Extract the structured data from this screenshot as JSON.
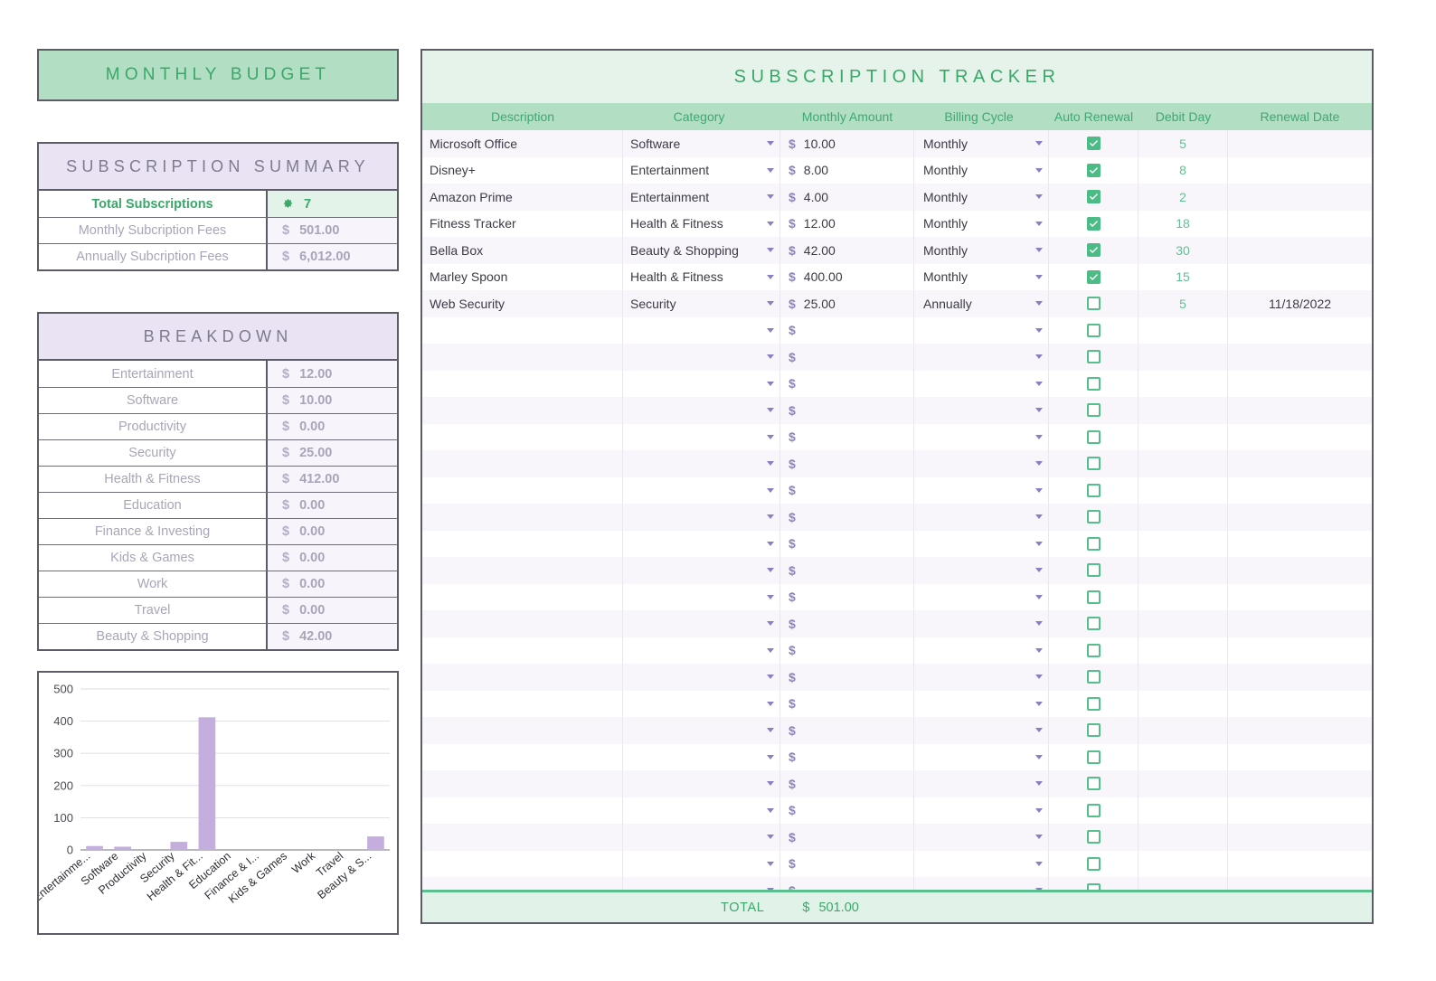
{
  "left": {
    "main_title": "MONTHLY BUDGET",
    "summary": {
      "title": "SUBSCRIPTION SUMMARY",
      "rows": [
        {
          "label": "Total Subscriptions",
          "currency": "",
          "value": "7",
          "icon": "flower-icon",
          "highlight": true
        },
        {
          "label": "Monthly Subcription Fees",
          "currency": "$",
          "value": "501.00",
          "highlight": false
        },
        {
          "label": "Annually Subcription Fees",
          "currency": "$",
          "value": "6,012.00",
          "highlight": false
        }
      ]
    },
    "breakdown": {
      "title": "BREAKDOWN",
      "rows": [
        {
          "label": "Entertainment",
          "currency": "$",
          "value": "12.00"
        },
        {
          "label": "Software",
          "currency": "$",
          "value": "10.00"
        },
        {
          "label": "Productivity",
          "currency": "$",
          "value": "0.00"
        },
        {
          "label": "Security",
          "currency": "$",
          "value": "25.00"
        },
        {
          "label": "Health & Fitness",
          "currency": "$",
          "value": "412.00"
        },
        {
          "label": "Education",
          "currency": "$",
          "value": "0.00"
        },
        {
          "label": "Finance & Investing",
          "currency": "$",
          "value": "0.00"
        },
        {
          "label": "Kids & Games",
          "currency": "$",
          "value": "0.00"
        },
        {
          "label": "Work",
          "currency": "$",
          "value": "0.00"
        },
        {
          "label": "Travel",
          "currency": "$",
          "value": "0.00"
        },
        {
          "label": "Beauty & Shopping",
          "currency": "$",
          "value": "42.00"
        }
      ]
    }
  },
  "chart_data": {
    "type": "bar",
    "title": "",
    "xlabel": "",
    "ylabel": "",
    "categories": [
      "Entertainment",
      "Software",
      "Productivity",
      "Security",
      "Health & Fitness",
      "Education",
      "Finance & Investing",
      "Kids & Games",
      "Work",
      "Travel",
      "Beauty & Shopping"
    ],
    "tick_labels_x": [
      "Entertainme...",
      "Software",
      "Productivity",
      "Security",
      "Health & Fit...",
      "Education",
      "Finance & I...",
      "Kids & Games",
      "Work",
      "Travel",
      "Beauty & S..."
    ],
    "values": [
      12,
      10,
      0,
      25,
      412,
      0,
      0,
      0,
      0,
      0,
      42
    ],
    "ylim": [
      0,
      500
    ],
    "yticks": [
      0,
      100,
      200,
      300,
      400,
      500
    ],
    "tick_labels_y": [
      "0",
      "100",
      "200",
      "300",
      "400",
      "500"
    ],
    "grid": true,
    "legend": false,
    "bar_color": "#c3aede"
  },
  "tracker": {
    "title": "SUBSCRIPTION TRACKER",
    "columns": [
      "Description",
      "Category",
      "Monthly Amount",
      "Billing Cycle",
      "Auto Renewal",
      "Debit Day",
      "Renewal Date"
    ],
    "rows": [
      {
        "description": "Microsoft Office",
        "category": "Software",
        "currency": "$",
        "amount": "10.00",
        "cycle": "Monthly",
        "auto_renewal": true,
        "debit_day": "5",
        "renewal_date": ""
      },
      {
        "description": "Disney+",
        "category": "Entertainment",
        "currency": "$",
        "amount": "8.00",
        "cycle": "Monthly",
        "auto_renewal": true,
        "debit_day": "8",
        "renewal_date": ""
      },
      {
        "description": "Amazon Prime",
        "category": "Entertainment",
        "currency": "$",
        "amount": "4.00",
        "cycle": "Monthly",
        "auto_renewal": true,
        "debit_day": "2",
        "renewal_date": ""
      },
      {
        "description": "Fitness Tracker",
        "category": "Health & Fitness",
        "currency": "$",
        "amount": "12.00",
        "cycle": "Monthly",
        "auto_renewal": true,
        "debit_day": "18",
        "renewal_date": ""
      },
      {
        "description": "Bella Box",
        "category": "Beauty & Shopping",
        "currency": "$",
        "amount": "42.00",
        "cycle": "Monthly",
        "auto_renewal": true,
        "debit_day": "30",
        "renewal_date": ""
      },
      {
        "description": "Marley Spoon",
        "category": "Health & Fitness",
        "currency": "$",
        "amount": "400.00",
        "cycle": "Monthly",
        "auto_renewal": true,
        "debit_day": "15",
        "renewal_date": ""
      },
      {
        "description": "Web Security",
        "category": "Security",
        "currency": "$",
        "amount": "25.00",
        "cycle": "Annually",
        "auto_renewal": false,
        "debit_day": "5",
        "renewal_date": "11/18/2022"
      }
    ],
    "empty_row_count": 22,
    "empty_row_currency": "$",
    "total_label": "TOTAL",
    "total_currency": "$",
    "total_value": "501.00"
  },
  "colors": {
    "green_accent": "#3aa869",
    "green_header": "#b2dec3",
    "green_title_band": "#e6f3ea",
    "purple_accent": "#7e7b90",
    "purple_band": "#e9e3f3",
    "row_alt": "#f8f5fb",
    "checkbox_on": "#4cbb86",
    "bar_purple": "#c3aede",
    "border_dark": "#5c5c66"
  }
}
